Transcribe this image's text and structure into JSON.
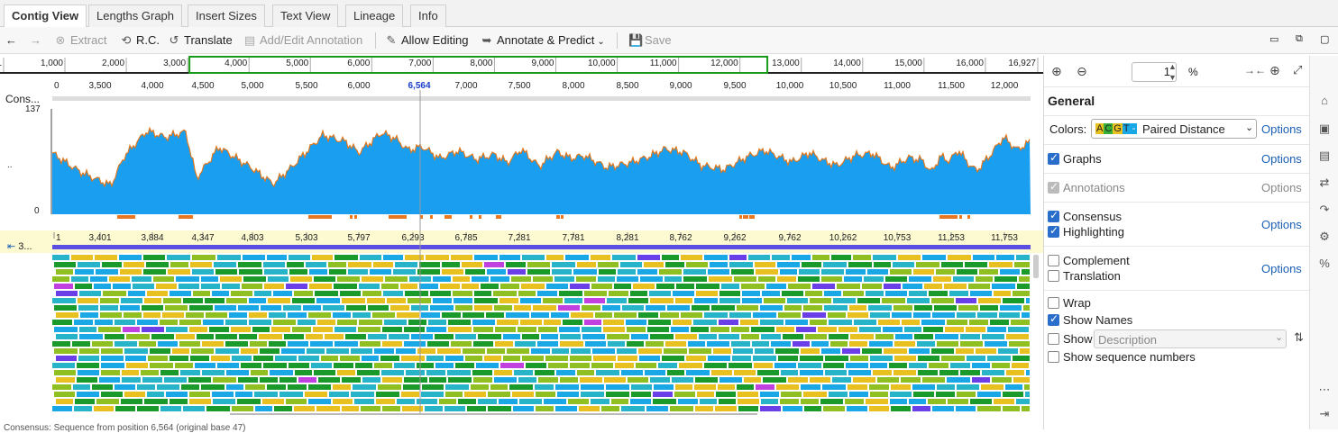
{
  "tabs": [
    {
      "label": "Contig View",
      "active": true
    },
    {
      "label": "Lengths Graph"
    },
    {
      "label": "Insert Sizes"
    },
    {
      "label": "Text View"
    },
    {
      "label": "Lineage"
    },
    {
      "label": "Info"
    }
  ],
  "toolbar": {
    "extract": "Extract",
    "rc": "R.C.",
    "translate": "Translate",
    "add_annotation": "Add/Edit Annotation",
    "allow_editing": "Allow Editing",
    "annotate_predict": "Annotate & Predict",
    "save": "Save"
  },
  "overview_ruler": {
    "ticks": [
      "1",
      "1,000",
      "2,000",
      "3,000",
      "4,000",
      "5,000",
      "6,000",
      "7,000",
      "8,000",
      "9,000",
      "10,000",
      "11,000",
      "12,000",
      "13,000",
      "14,000",
      "15,000",
      "16,000",
      "16,927"
    ],
    "view_start": 3000,
    "view_end": 12300,
    "total": 16927
  },
  "consensus_ruler": {
    "ticks": [
      "0",
      "3,500",
      "4,000",
      "4,500",
      "5,000",
      "5,500",
      "6,000",
      "6,564",
      "7,000",
      "7,500",
      "8,000",
      "8,500",
      "9,000",
      "9,500",
      "10,000",
      "10,500",
      "11,000",
      "11,500",
      "12,000"
    ],
    "cursor": "6,564"
  },
  "graph": {
    "track_label": "Cons...",
    "y_max": "137",
    "y_min": "0",
    "y_mid": "..",
    "colors": {
      "coverage": "#1a9ff0",
      "edge": "#e0781e",
      "highlight": "#e87722"
    }
  },
  "reads_ruler": {
    "ticks": [
      "1",
      "3,401",
      "3,884",
      "4,347",
      "4,803",
      "5,303",
      "5,797",
      "6,293",
      "6,785",
      "7,281",
      "7,781",
      "8,281",
      "8,762",
      "9,262",
      "9,762",
      "10,262",
      "10,753",
      "11,253",
      "11,753"
    ],
    "row_label": "3..."
  },
  "status": "Consensus: Sequence from position 6,564 (original base 47)",
  "zoom": {
    "value": "1",
    "unit": "%"
  },
  "panel": {
    "title": "General",
    "colors_label": "Colors:",
    "colors_swatch": "ACGT-",
    "colors_value": "Paired Distance",
    "options": "Options",
    "graphs": "Graphs",
    "annotations": "Annotations",
    "consensus": "Consensus",
    "highlighting": "Highlighting",
    "complement": "Complement",
    "translation": "Translation",
    "wrap": "Wrap",
    "show_names": "Show Names",
    "show": "Show",
    "show_value": "Description",
    "show_seq_numbers": "Show sequence numbers"
  }
}
